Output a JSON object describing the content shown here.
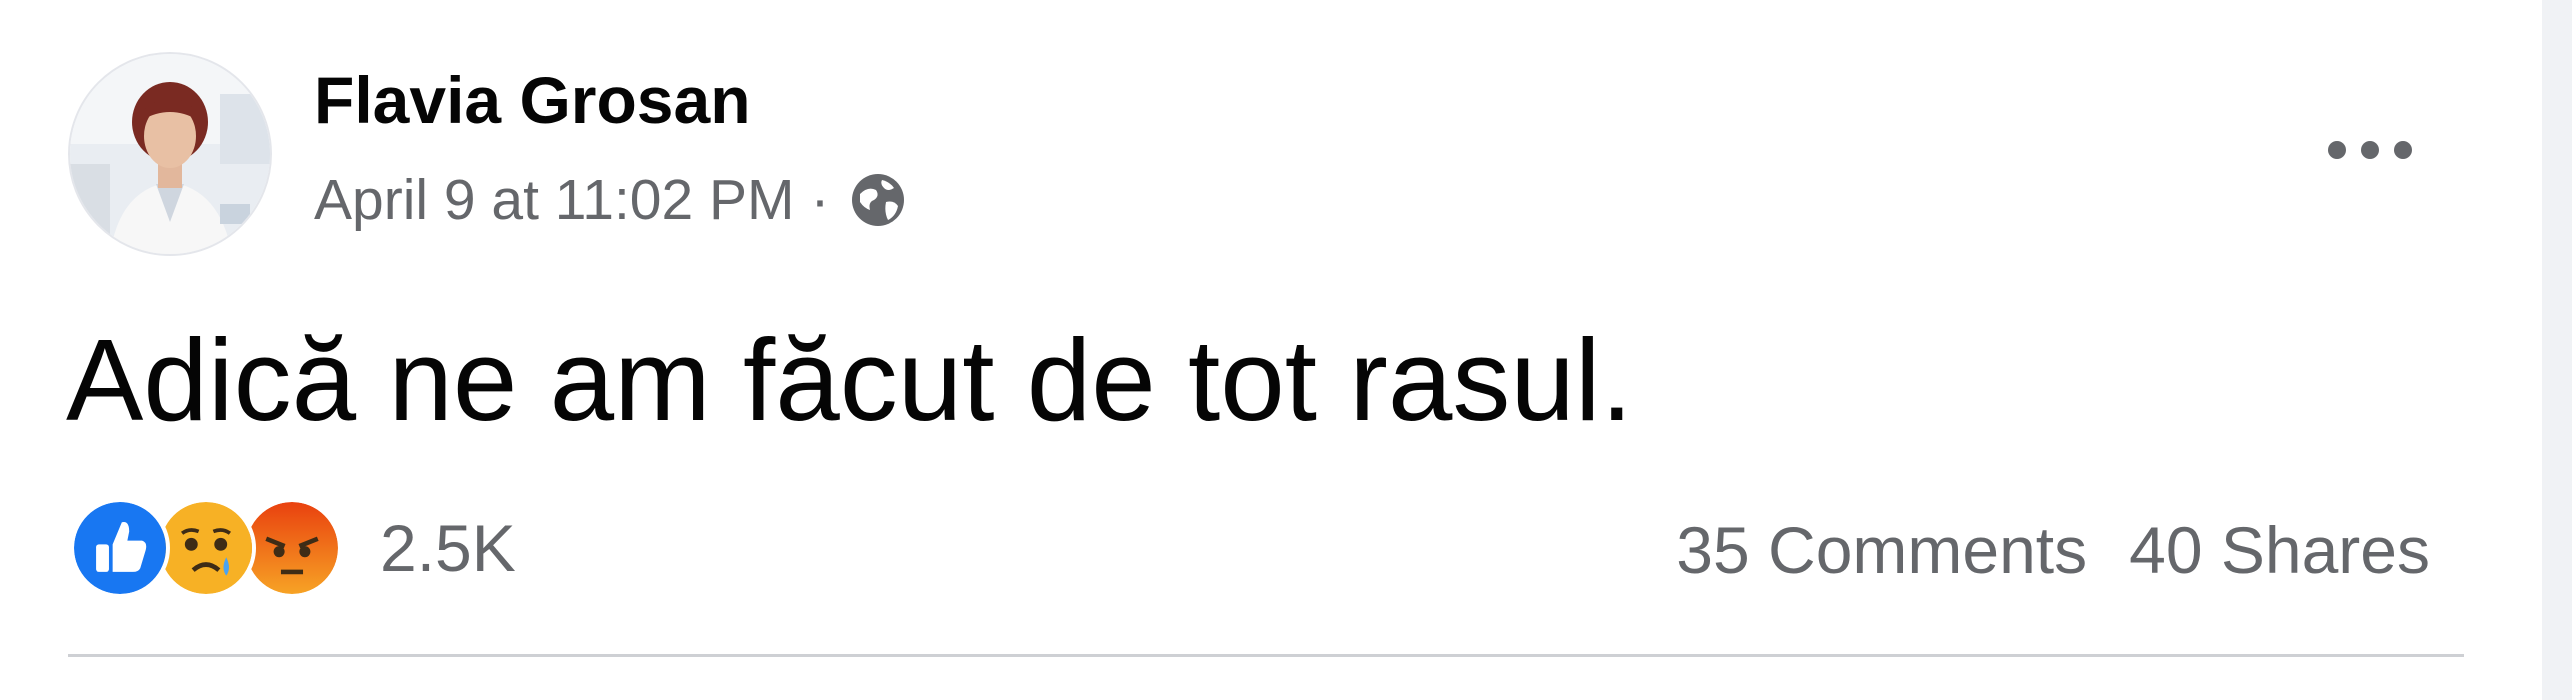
{
  "post": {
    "author": "Flavia Grosan",
    "timestamp": "April 9 at 11:02 PM",
    "separator": "·",
    "privacy_icon": "globe-icon",
    "text": "Adică ne am făcut de tot rasul.",
    "menu_icon": "more-horizontal-icon"
  },
  "reactions": {
    "icons": [
      "like-icon",
      "sad-icon",
      "angry-icon"
    ],
    "count": "2.5K"
  },
  "engagement": {
    "comments": "35 Comments",
    "shares": "40 Shares"
  },
  "colors": {
    "like": "#1877f2",
    "sad": "#f7b125",
    "angry": "#e9710f",
    "secondary_text": "#65676b",
    "primary_text": "#050505"
  }
}
